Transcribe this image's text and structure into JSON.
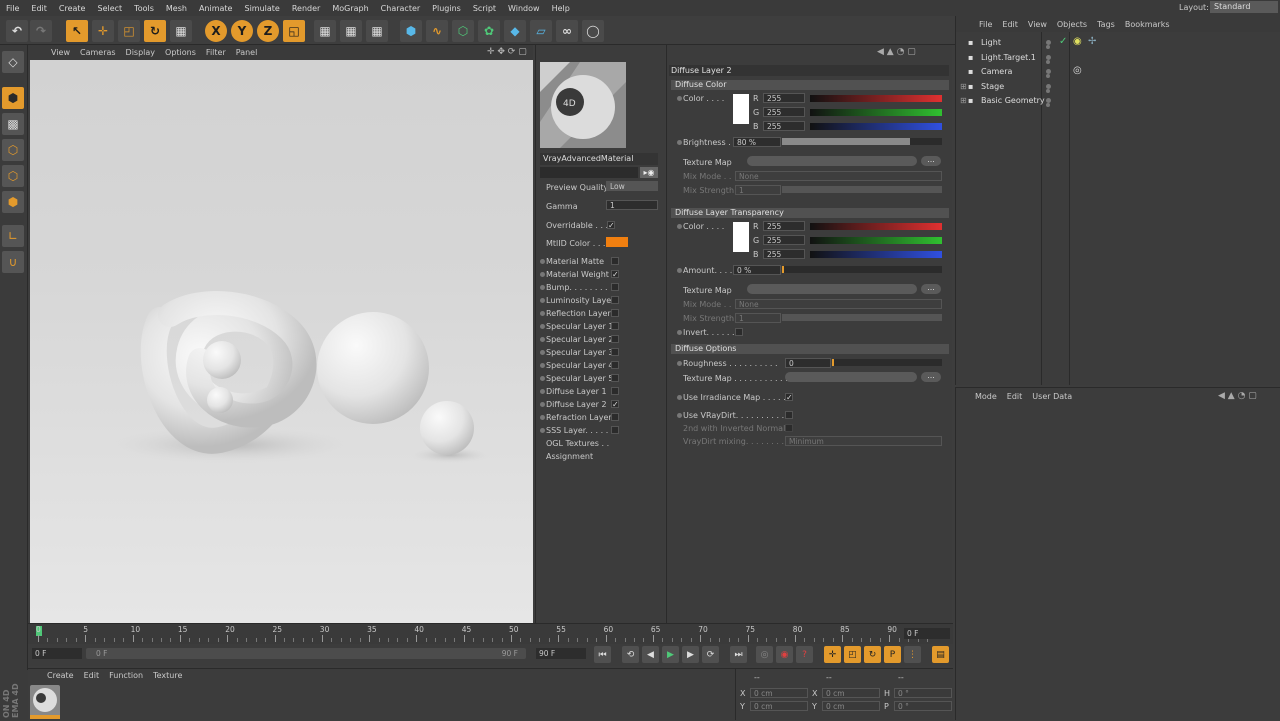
{
  "menu": [
    "File",
    "Edit",
    "Create",
    "Select",
    "Tools",
    "Mesh",
    "Animate",
    "Simulate",
    "Render",
    "MoGraph",
    "Character",
    "Plugins",
    "Script",
    "Window",
    "Help"
  ],
  "layout": {
    "label": "Layout:",
    "value": "Standard"
  },
  "toolbar": {
    "x": "X",
    "y": "Y",
    "z": "Z"
  },
  "viewport_menu": [
    "View",
    "Cameras",
    "Display",
    "Options",
    "Filter",
    "Panel"
  ],
  "material": {
    "name": "VrayAdvancedMaterial",
    "preview_quality_label": "Preview Quality",
    "preview_quality_value": "Low",
    "gamma_label": "Gamma",
    "gamma_value": "1",
    "overridable_label": "Overridable . . .",
    "mtlid_label": "MtlID Color . . .",
    "mtlid_color": "#f07f10",
    "channels": [
      {
        "label": "Material Matte",
        "checked": false
      },
      {
        "label": "Material Weight",
        "checked": true
      },
      {
        "label": "Bump. . . . . . . . .",
        "checked": false
      },
      {
        "label": "Luminosity Layer",
        "checked": false
      },
      {
        "label": "Reflection Layer",
        "checked": false
      },
      {
        "label": "Specular Layer 1",
        "checked": false
      },
      {
        "label": "Specular Layer 2",
        "checked": false
      },
      {
        "label": "Specular Layer 3",
        "checked": false
      },
      {
        "label": "Specular Layer 4",
        "checked": false
      },
      {
        "label": "Specular Layer 5",
        "checked": false
      },
      {
        "label": "Diffuse Layer 1",
        "checked": false
      },
      {
        "label": "Diffuse Layer 2",
        "checked": true
      },
      {
        "label": "Refraction Layer",
        "checked": false
      },
      {
        "label": "SSS Layer. . . . . .",
        "checked": false
      }
    ],
    "ogl_label": "OGL Textures . .",
    "assignment_label": "Assignment",
    "check_mark": "✓"
  },
  "attributes": {
    "title": "Diffuse Layer 2",
    "diffuse_color": {
      "header": "Diffuse Color",
      "color_label": "Color . . . .",
      "r_label": "R",
      "g_label": "G",
      "b_label": "B",
      "r": "255",
      "g": "255",
      "b": "255",
      "brightness_label": "Brightness . .",
      "brightness": "80 %",
      "texture_label": "Texture Map",
      "mixmode_label": "Mix Mode . .",
      "mixmode": "None",
      "mixstrength_label": "Mix Strength",
      "mixstrength": "1",
      "dots": "..."
    },
    "transparency": {
      "header": "Diffuse Layer Transparency",
      "color_label": "Color . . . .",
      "r": "255",
      "g": "255",
      "b": "255",
      "amount_label": "Amount. . . .",
      "amount": "0 %",
      "texture_label": "Texture Map",
      "mixmode_label": "Mix Mode . .",
      "mixmode": "None",
      "mixstrength_label": "Mix Strength",
      "mixstrength": "1",
      "invert_label": "Invert. . . . . .",
      "dots": "..."
    },
    "options": {
      "header": "Diffuse Options",
      "roughness_label": "Roughness . . . . . . . . . .",
      "roughness": "0",
      "texture_label": "Texture Map . . . . . . . . . . .",
      "irradiance_label": "Use Irradiance Map . . . . . .",
      "vraydirt_label": "Use VRayDirt. . . . . . . . . . .",
      "inverted_label": "2nd with Inverted Normals",
      "vraydirt_mix_label": "VrayDirt mixing. . . . . . . . .",
      "vraydirt_mix": "Minimum",
      "dots": "..."
    }
  },
  "objects_menu": [
    "File",
    "Edit",
    "View",
    "Objects",
    "Tags",
    "Bookmarks"
  ],
  "objects": [
    "Light",
    "Light.Target.1",
    "Camera",
    "Stage",
    "Basic Geometry"
  ],
  "attr_manager_menu": [
    "Mode",
    "Edit",
    "User Data"
  ],
  "timeline": {
    "ticks": [
      "0",
      "5",
      "10",
      "15",
      "20",
      "25",
      "30",
      "35",
      "40",
      "45",
      "50",
      "55",
      "60",
      "65",
      "70",
      "75",
      "80",
      "85",
      "90"
    ],
    "end_frame": "0 F"
  },
  "transport": {
    "start": "0 F",
    "scroll_start": "0 F",
    "scroll_end": "90 F",
    "end": "90 F"
  },
  "material_manager_menu": [
    "Create",
    "Edit",
    "Function",
    "Texture"
  ],
  "coords": {
    "header": [
      "--",
      "--",
      "--"
    ],
    "rows": [
      {
        "a": "X",
        "av": "0 cm",
        "b": "X",
        "bv": "0 cm",
        "c": "H",
        "cv": "0 °"
      },
      {
        "a": "Y",
        "av": "0 cm",
        "b": "Y",
        "bv": "0 cm",
        "c": "P",
        "cv": "0 °"
      }
    ]
  },
  "brand": "ON 4D\nEMA 4D"
}
